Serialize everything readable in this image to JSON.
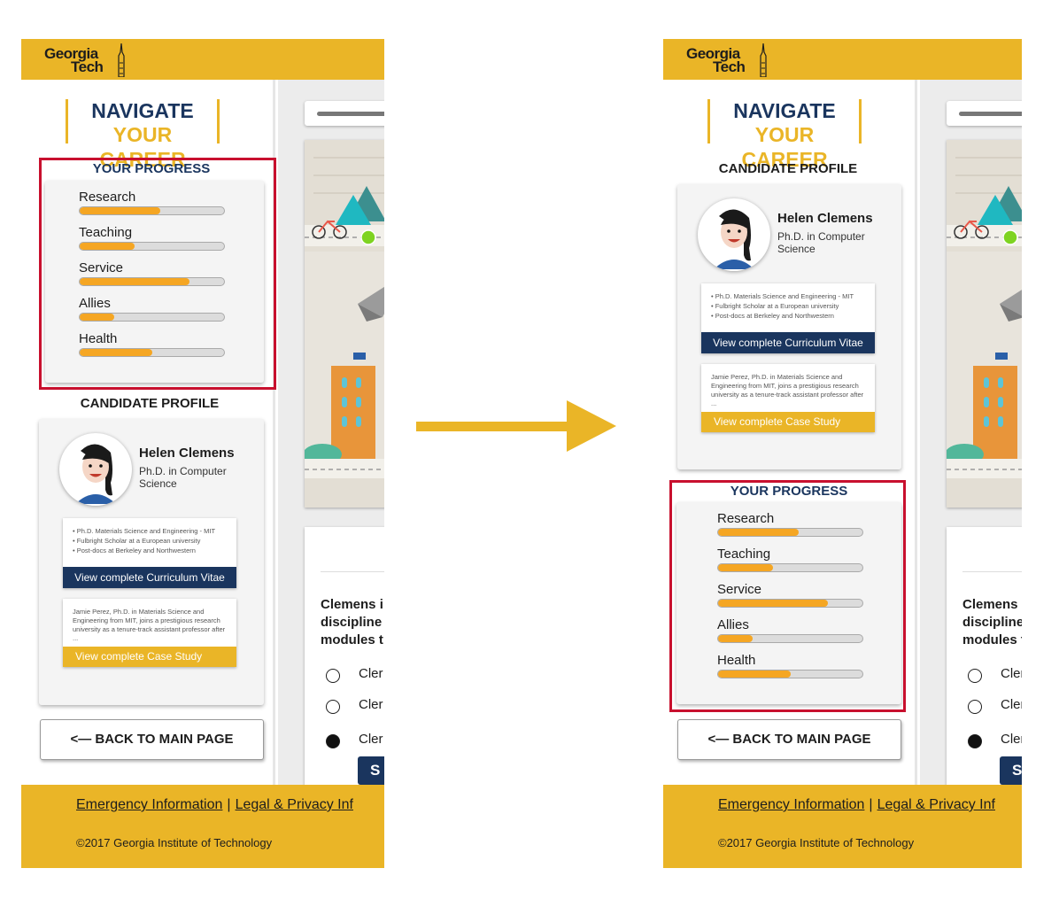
{
  "header": {
    "logo_line1": "Georgia",
    "logo_line2": "Tech"
  },
  "sidebar": {
    "title_line1": "NAVIGATE",
    "title_line2": "YOUR CAREER",
    "progress_title": "YOUR PROGRESS",
    "profile_title": "CANDIDATE PROFILE",
    "progress": [
      {
        "label": "Research",
        "value": 0.56
      },
      {
        "label": "Teaching",
        "value": 0.38
      },
      {
        "label": "Service",
        "value": 0.76
      },
      {
        "label": "Allies",
        "value": 0.24
      },
      {
        "label": "Health",
        "value": 0.5
      }
    ],
    "candidate": {
      "name": "Helen Clemens",
      "degree": "Ph.D. in Computer Science",
      "cv_bullets": [
        "• Ph.D.  Materials Science and Engineering - MIT",
        "• Fulbright Scholar at a European university",
        "• Post-docs at Berkeley and Northwestern"
      ],
      "cv_button": "View complete Curriculum Vitae",
      "case_text": "Jamie Perez, Ph.D. in Materials Science and Engineering from MIT, joins a prestigious research university as a tenure-track assistant professor after ...",
      "case_button": "View complete Case Study"
    },
    "back_button": "<— BACK TO MAIN PAGE"
  },
  "main": {
    "question_lines": [
      "Clemens i",
      "discipline",
      "modules t"
    ],
    "options": [
      "Cler",
      "Cler",
      "Cler"
    ],
    "selected_option": 2,
    "submit_label": "S"
  },
  "footer": {
    "link1": "Emergency Information",
    "separator": "|",
    "link2": "Legal & Privacy Inf",
    "copyright": "©2017 Georgia Institute of Technology"
  },
  "colors": {
    "gold": "#EAB527",
    "navy": "#1a355e",
    "progress_fill": "#F5A623",
    "highlight": "#c8102e"
  }
}
